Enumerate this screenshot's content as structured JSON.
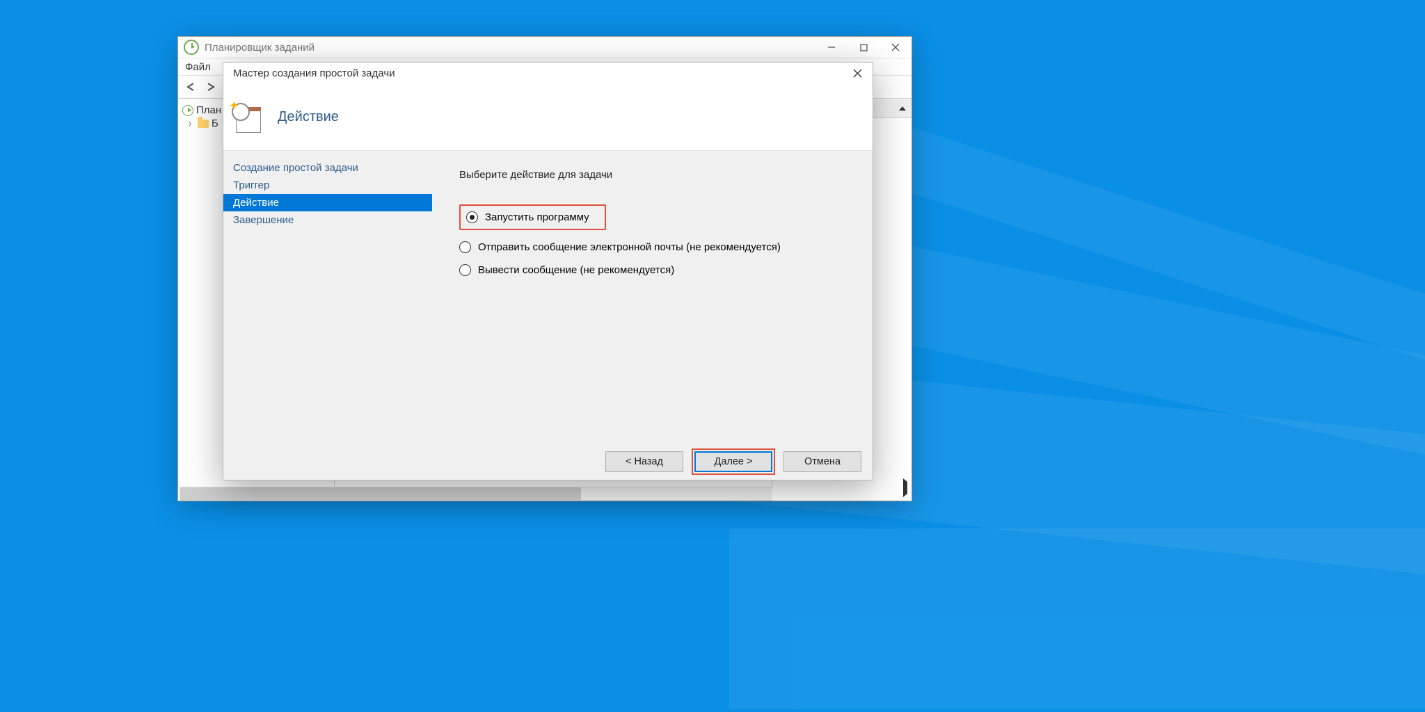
{
  "parent": {
    "title": "Планировщик заданий",
    "menu_file": "Файл",
    "tree": {
      "root": "План",
      "child": "Б"
    }
  },
  "dialog": {
    "title": "Мастер создания простой задачи",
    "header": "Действие",
    "steps": {
      "create": "Создание простой задачи",
      "trigger": "Триггер",
      "action": "Действие",
      "finish": "Завершение"
    },
    "prompt": "Выберите действие для задачи",
    "options": {
      "run_program": "Запустить программу",
      "send_email": "Отправить сообщение электронной почты (не рекомендуется)",
      "show_message": "Вывести сообщение (не рекомендуется)"
    },
    "buttons": {
      "back": "< Назад",
      "next": "Далее >",
      "cancel": "Отмена"
    }
  }
}
